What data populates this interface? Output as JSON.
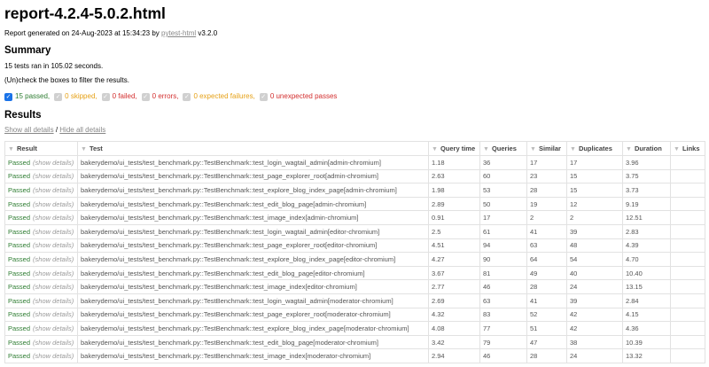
{
  "title": "report-4.2.4-5.0.2.html",
  "generated": {
    "prefix": "Report generated on 24-Aug-2023 at 15:34:23 by ",
    "link": "pytest-html",
    "suffix": " v3.2.0"
  },
  "summary": {
    "heading": "Summary",
    "tests_ran": "15 tests ran in 105.02 seconds.",
    "check_hint": "(Un)check the boxes to filter the results.",
    "filters": [
      {
        "label": "15 passed,",
        "checked": true
      },
      {
        "label": "0 skipped,",
        "checked": false
      },
      {
        "label": "0 failed,",
        "checked": false
      },
      {
        "label": "0 errors,",
        "checked": false
      },
      {
        "label": "0 expected failures,",
        "checked": false
      },
      {
        "label": "0 unexpected passes",
        "checked": false
      }
    ]
  },
  "results": {
    "heading": "Results",
    "show_all": "Show all details",
    "separator": " / ",
    "hide_all": "Hide all details",
    "columns": [
      "Result",
      "Test",
      "Query time",
      "Queries",
      "Similar",
      "Duplicates",
      "Duration",
      "Links"
    ],
    "show_details": "(show details)",
    "rows": [
      {
        "result": "Passed",
        "test": "bakerydemo/ui_tests/test_benchmark.py::TestBenchmark::test_login_wagtail_admin[admin-chromium]",
        "query_time": "1.18",
        "queries": "36",
        "similar": "17",
        "duplicates": "17",
        "duration": "3.96"
      },
      {
        "result": "Passed",
        "test": "bakerydemo/ui_tests/test_benchmark.py::TestBenchmark::test_page_explorer_root[admin-chromium]",
        "query_time": "2.63",
        "queries": "60",
        "similar": "23",
        "duplicates": "15",
        "duration": "3.75"
      },
      {
        "result": "Passed",
        "test": "bakerydemo/ui_tests/test_benchmark.py::TestBenchmark::test_explore_blog_index_page[admin-chromium]",
        "query_time": "1.98",
        "queries": "53",
        "similar": "28",
        "duplicates": "15",
        "duration": "3.73"
      },
      {
        "result": "Passed",
        "test": "bakerydemo/ui_tests/test_benchmark.py::TestBenchmark::test_edit_blog_page[admin-chromium]",
        "query_time": "2.89",
        "queries": "50",
        "similar": "19",
        "duplicates": "12",
        "duration": "9.19"
      },
      {
        "result": "Passed",
        "test": "bakerydemo/ui_tests/test_benchmark.py::TestBenchmark::test_image_index[admin-chromium]",
        "query_time": "0.91",
        "queries": "17",
        "similar": "2",
        "duplicates": "2",
        "duration": "12.51"
      },
      {
        "result": "Passed",
        "test": "bakerydemo/ui_tests/test_benchmark.py::TestBenchmark::test_login_wagtail_admin[editor-chromium]",
        "query_time": "2.5",
        "queries": "61",
        "similar": "41",
        "duplicates": "39",
        "duration": "2.83"
      },
      {
        "result": "Passed",
        "test": "bakerydemo/ui_tests/test_benchmark.py::TestBenchmark::test_page_explorer_root[editor-chromium]",
        "query_time": "4.51",
        "queries": "94",
        "similar": "63",
        "duplicates": "48",
        "duration": "4.39"
      },
      {
        "result": "Passed",
        "test": "bakerydemo/ui_tests/test_benchmark.py::TestBenchmark::test_explore_blog_index_page[editor-chromium]",
        "query_time": "4.27",
        "queries": "90",
        "similar": "64",
        "duplicates": "54",
        "duration": "4.70"
      },
      {
        "result": "Passed",
        "test": "bakerydemo/ui_tests/test_benchmark.py::TestBenchmark::test_edit_blog_page[editor-chromium]",
        "query_time": "3.67",
        "queries": "81",
        "similar": "49",
        "duplicates": "40",
        "duration": "10.40"
      },
      {
        "result": "Passed",
        "test": "bakerydemo/ui_tests/test_benchmark.py::TestBenchmark::test_image_index[editor-chromium]",
        "query_time": "2.77",
        "queries": "46",
        "similar": "28",
        "duplicates": "24",
        "duration": "13.15"
      },
      {
        "result": "Passed",
        "test": "bakerydemo/ui_tests/test_benchmark.py::TestBenchmark::test_login_wagtail_admin[moderator-chromium]",
        "query_time": "2.69",
        "queries": "63",
        "similar": "41",
        "duplicates": "39",
        "duration": "2.84"
      },
      {
        "result": "Passed",
        "test": "bakerydemo/ui_tests/test_benchmark.py::TestBenchmark::test_page_explorer_root[moderator-chromium]",
        "query_time": "4.32",
        "queries": "83",
        "similar": "52",
        "duplicates": "42",
        "duration": "4.15"
      },
      {
        "result": "Passed",
        "test": "bakerydemo/ui_tests/test_benchmark.py::TestBenchmark::test_explore_blog_index_page[moderator-chromium]",
        "query_time": "4.08",
        "queries": "77",
        "similar": "51",
        "duplicates": "42",
        "duration": "4.36"
      },
      {
        "result": "Passed",
        "test": "bakerydemo/ui_tests/test_benchmark.py::TestBenchmark::test_edit_blog_page[moderator-chromium]",
        "query_time": "3.42",
        "queries": "79",
        "similar": "47",
        "duplicates": "38",
        "duration": "10.39"
      },
      {
        "result": "Passed",
        "test": "bakerydemo/ui_tests/test_benchmark.py::TestBenchmark::test_image_index[moderator-chromium]",
        "query_time": "2.94",
        "queries": "46",
        "similar": "28",
        "duplicates": "24",
        "duration": "13.32"
      }
    ]
  }
}
